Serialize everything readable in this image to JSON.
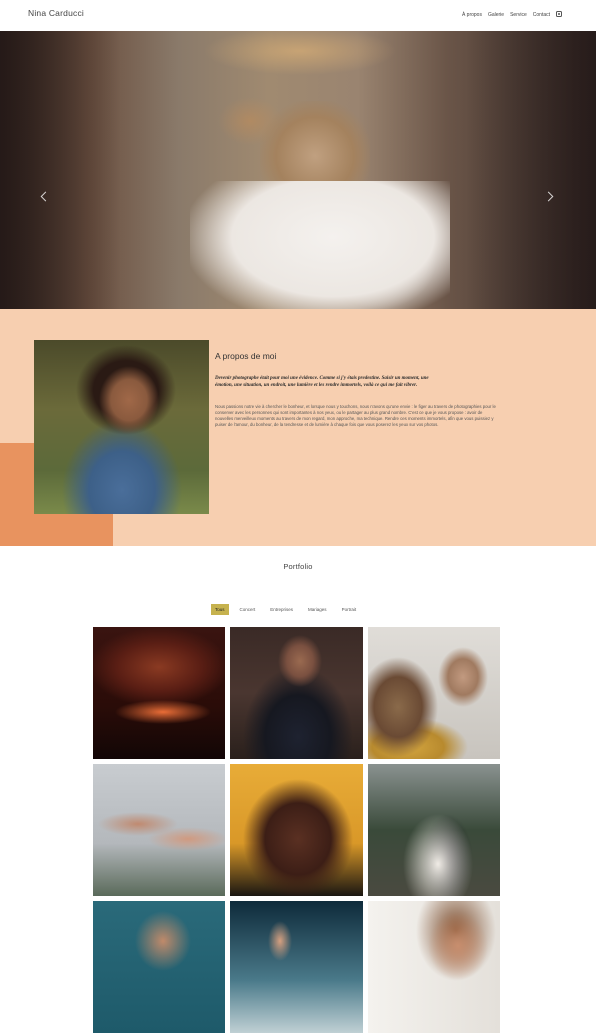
{
  "header": {
    "brand": "Nina Carducci",
    "nav": [
      "À propos",
      "Galerie",
      "Service",
      "Contact"
    ],
    "icon": "instagram-icon"
  },
  "hero": {
    "slides": 3,
    "active_slide": 3,
    "prev_icon": "chevron-left-icon",
    "next_icon": "chevron-right-icon"
  },
  "about": {
    "title": "A propos de moi",
    "lead": "Devenir photographe était pour moi une évidence. Comme si j'y étais predestine. Saisir un moment, une émotion, une situation, un endroit, une lumière et les rendre immortels, voilà ce qui me fait vibrer.",
    "body": "Nous passions notre vie à chercher le bonheur, et lorsque nous y touchons, nous n'avons qu'une envie : le figer au travers de photographies pour le conserver avec les personnes qui sont importantes à nos yeux, ou le partager au plus grand nombre. C'est ce que je vous propose : avoir de nouvelles merveilleux moments au travers de mon regard, mon approche, ma technique. Rendre ces moments immortels, afin que vous puissiez y puiser de l'amour, du bonheur, de la tendresse et de lumière à chaque fois que vous poserez les yeux sur vos photos.",
    "colors": {
      "background": "#f7cfb0",
      "accent": "#e8935f"
    }
  },
  "portfolio": {
    "title": "Portfolio",
    "filters": [
      "Tous",
      "Concert",
      "Entreprises",
      "Mariages",
      "Portrait"
    ],
    "active_filter": "Tous",
    "accent": "#c6b24e",
    "images": [
      "concert-crowd",
      "businessman-portrait",
      "smiling-woman-event",
      "hands-reaching",
      "man-portrait",
      "wedding-couple",
      "woman-glasses-portrait",
      "concert-hand",
      "laughing-woman-portrait"
    ]
  }
}
